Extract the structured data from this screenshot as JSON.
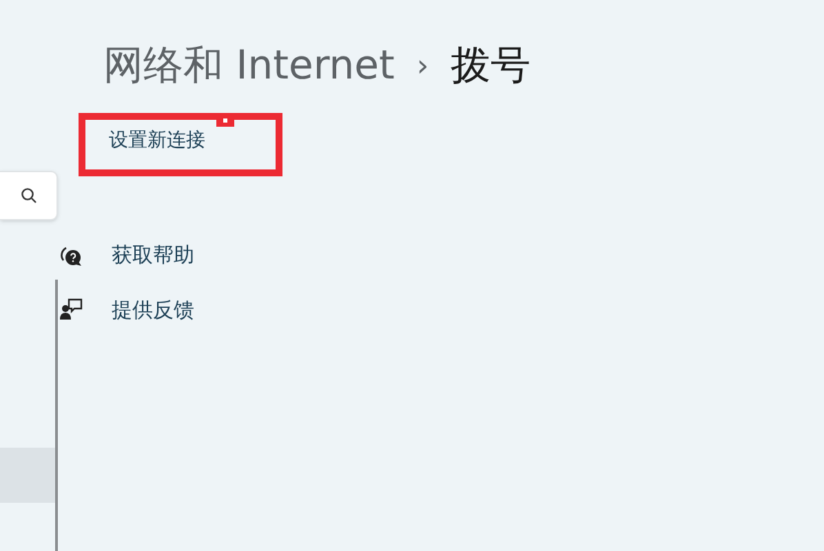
{
  "breadcrumb": {
    "parent": "网络和 Internet",
    "separator": "›",
    "current": "拨号"
  },
  "link": {
    "label": "设置新连接",
    "highlighted": true
  },
  "sidebar": {
    "items": [
      {
        "selected": true
      }
    ]
  },
  "help_links": [
    {
      "kind": "help",
      "label": "获取帮助"
    },
    {
      "kind": "feedback",
      "label": "提供反馈"
    }
  ]
}
